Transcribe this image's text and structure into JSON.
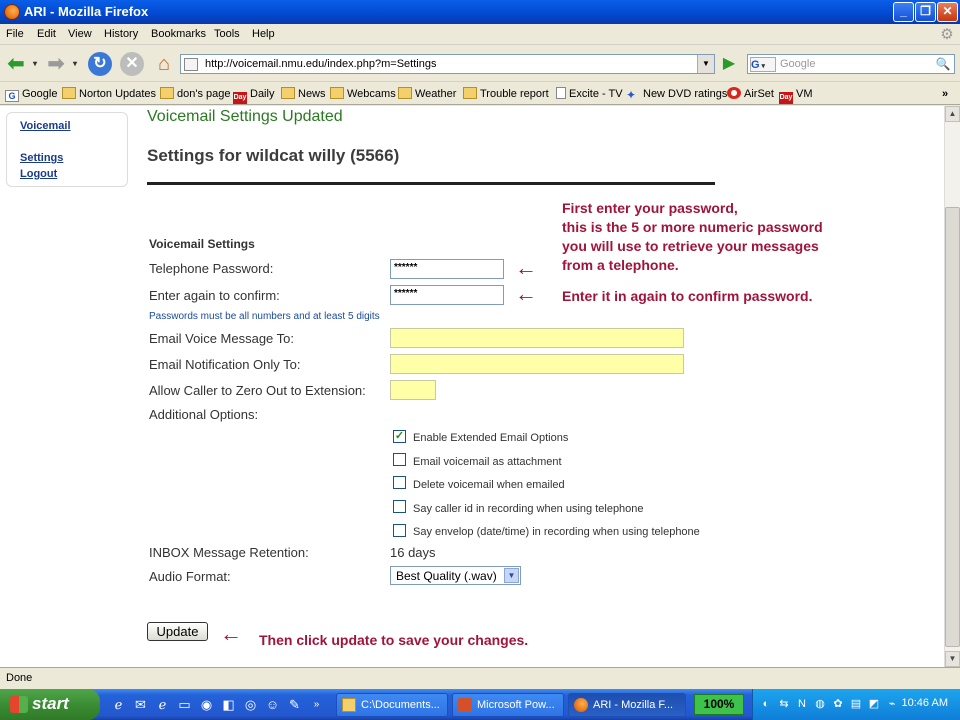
{
  "window": {
    "title": "ARI - Mozilla Firefox"
  },
  "menu": [
    "File",
    "Edit",
    "View",
    "History",
    "Bookmarks",
    "Tools",
    "Help"
  ],
  "nav": {
    "url": "http://voicemail.nmu.edu/index.php?m=Settings",
    "search_placeholder": "Google",
    "search_engine": "G"
  },
  "bookmarks": [
    {
      "label": "Google",
      "icon": "g"
    },
    {
      "label": "Norton Updates",
      "icon": "folder"
    },
    {
      "label": "don's page",
      "icon": "folder"
    },
    {
      "label": "Daily",
      "icon": "day"
    },
    {
      "label": "News",
      "icon": "folder"
    },
    {
      "label": "Webcams",
      "icon": "folder"
    },
    {
      "label": "Weather",
      "icon": "folder"
    },
    {
      "label": "Trouble report",
      "icon": "folder"
    },
    {
      "label": "Excite - TV",
      "icon": "page"
    },
    {
      "label": "New DVD ratings",
      "icon": "star"
    },
    {
      "label": "AirSet",
      "icon": "airset"
    },
    {
      "label": "VM",
      "icon": "day"
    }
  ],
  "bookmark_overflow": "»",
  "sidebar": {
    "voicemail": "Voicemail",
    "settings": "Settings",
    "logout": "Logout"
  },
  "page": {
    "message": "Voicemail Settings Updated",
    "title": "Settings for wildcat willy (5566)",
    "section": "Voicemail Settings",
    "fields": {
      "telephone_password": {
        "label": "Telephone Password:",
        "value": "******"
      },
      "confirm_password": {
        "label": "Enter again to confirm:",
        "value": "******"
      },
      "password_hint": "Passwords must be all numbers and at least 5 digits",
      "email_voice": {
        "label": "Email Voice Message To:",
        "value": ""
      },
      "email_notify": {
        "label": "Email Notification Only To:",
        "value": ""
      },
      "zero_out": {
        "label": "Allow Caller to Zero Out to Extension:",
        "value": ""
      },
      "additional": "Additional Options:"
    },
    "options": [
      {
        "label": "Enable Extended Email Options",
        "checked": true
      },
      {
        "label": "Email voicemail as attachment",
        "checked": false
      },
      {
        "label": "Delete voicemail when emailed",
        "checked": false
      },
      {
        "label": "Say caller id in recording when using telephone",
        "checked": false
      },
      {
        "label": "Say envelop (date/time) in recording when using telephone",
        "checked": false
      }
    ],
    "retention": {
      "label": "INBOX Message Retention:",
      "value": "16 days"
    },
    "audio": {
      "label": "Audio Format:",
      "value": "Best Quality (.wav)"
    },
    "update_button": "Update"
  },
  "annotations": {
    "line1": "First enter your password,",
    "line2": "this is the 5 or more numeric password",
    "line3": "you will use to retrieve your messages",
    "line4": "from a telephone.",
    "confirm": "Enter it in again to confirm password.",
    "update": "Then click update to save your changes.",
    "arrow": "←"
  },
  "status": "Done",
  "taskbar": {
    "start": "start",
    "tasks": [
      {
        "label": "C:\\Documents...",
        "icon": "folder"
      },
      {
        "label": "Microsoft Pow...",
        "icon": "powerpoint"
      },
      {
        "label": "ARI - Mozilla F...",
        "icon": "firefox",
        "active": true
      }
    ],
    "zoom": "100%",
    "clock": "10:46 AM"
  },
  "colors": {
    "annotation": "#a0143a",
    "message": "#2a7a22",
    "link": "#1a3a8a",
    "highlight_field": "#ffffa8"
  }
}
